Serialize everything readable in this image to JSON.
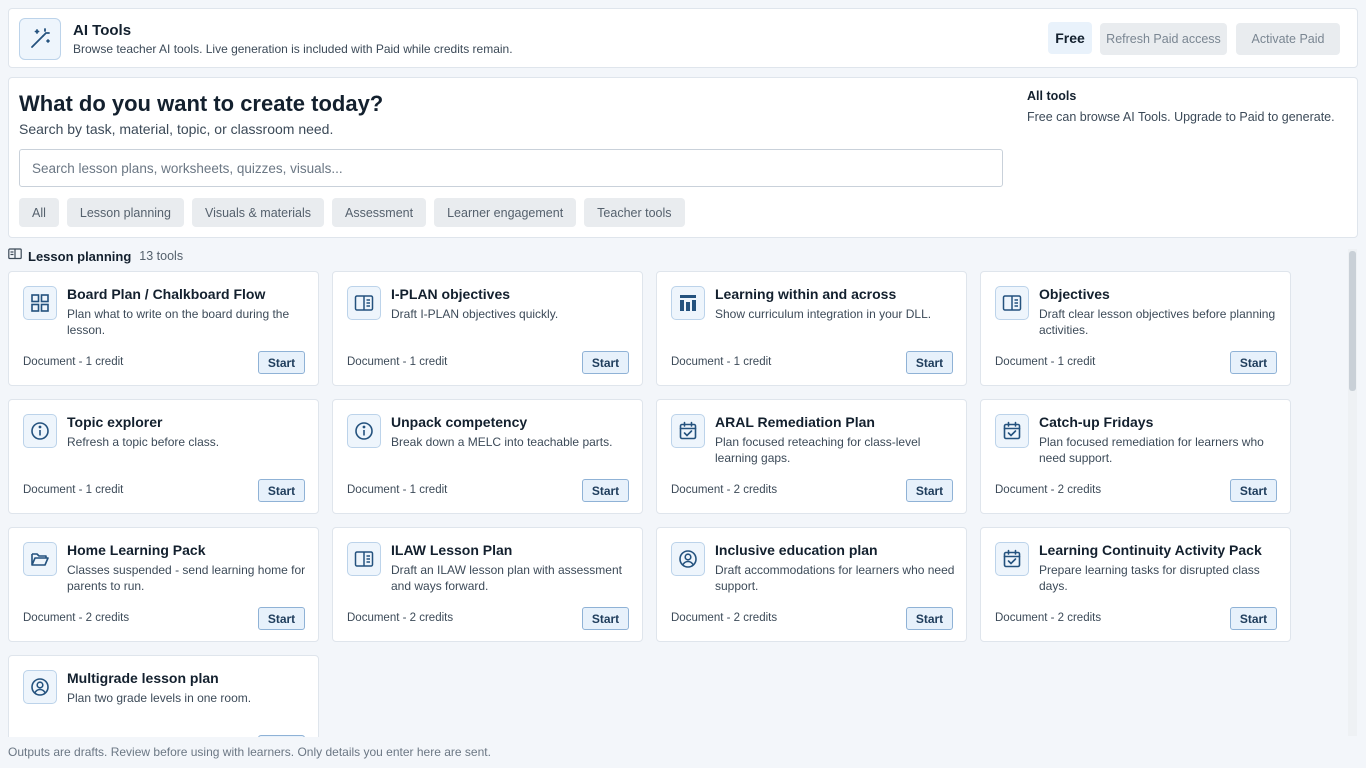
{
  "header": {
    "title": "AI Tools",
    "subtitle": "Browse teacher AI tools. Live generation is included with Paid while credits remain.",
    "plan_badge": "Free",
    "refresh_label": "Refresh Paid access",
    "activate_label": "Activate Paid",
    "icon": "magic-wand-icon"
  },
  "search": {
    "title": "What do you want to create today?",
    "subtitle": "Search by task, material, topic, or classroom need.",
    "placeholder": "Search lesson plans, worksheets, quizzes, visuals...",
    "value": "",
    "filters": [
      "All",
      "Lesson planning",
      "Visuals & materials",
      "Assessment",
      "Learner engagement",
      "Teacher tools"
    ]
  },
  "scope": {
    "title": "All tools",
    "description": "Free can browse AI Tools. Upgrade to Paid to generate."
  },
  "section": {
    "title": "Lesson planning",
    "count": "13 tools",
    "icon": "book-open-icon"
  },
  "tools": [
    {
      "title": "Board Plan / Chalkboard Flow",
      "desc": "Plan what to write on the board during the lesson.",
      "meta": "Document - 1 credit",
      "start": "Start",
      "icon": "grid-icon"
    },
    {
      "title": "I-PLAN objectives",
      "desc": "Draft I-PLAN objectives quickly.",
      "meta": "Document - 1 credit",
      "start": "Start",
      "icon": "book-icon"
    },
    {
      "title": "Learning within and across",
      "desc": "Show curriculum integration in your DLL.",
      "meta": "Document - 1 credit",
      "start": "Start",
      "icon": "layout-icon"
    },
    {
      "title": "Objectives",
      "desc": "Draft clear lesson objectives before planning activities.",
      "meta": "Document - 1 credit",
      "start": "Start",
      "icon": "book-icon"
    },
    {
      "title": "Topic explorer",
      "desc": "Refresh a topic before class.",
      "meta": "Document - 1 credit",
      "start": "Start",
      "icon": "info-icon"
    },
    {
      "title": "Unpack competency",
      "desc": "Break down a MELC into teachable parts.",
      "meta": "Document - 1 credit",
      "start": "Start",
      "icon": "info-icon"
    },
    {
      "title": "ARAL Remediation Plan",
      "desc": "Plan focused reteaching for class-level learning gaps.",
      "meta": "Document - 2 credits",
      "start": "Start",
      "icon": "calendar-check-icon"
    },
    {
      "title": "Catch-up Fridays",
      "desc": "Plan focused remediation for learners who need support.",
      "meta": "Document - 2 credits",
      "start": "Start",
      "icon": "calendar-check-icon"
    },
    {
      "title": "Home Learning Pack",
      "desc": "Classes suspended - send learning home for parents to run.",
      "meta": "Document - 2 credits",
      "start": "Start",
      "icon": "folder-open-icon"
    },
    {
      "title": "ILAW Lesson Plan",
      "desc": "Draft an ILAW lesson plan with assessment and ways forward.",
      "meta": "Document - 2 credits",
      "start": "Start",
      "icon": "book-icon"
    },
    {
      "title": "Inclusive education plan",
      "desc": "Draft accommodations for learners who need support.",
      "meta": "Document - 2 credits",
      "start": "Start",
      "icon": "user-circle-icon"
    },
    {
      "title": "Learning Continuity Activity Pack",
      "desc": "Prepare learning tasks for disrupted class days.",
      "meta": "Document - 2 credits",
      "start": "Start",
      "icon": "calendar-check-icon"
    },
    {
      "title": "Multigrade lesson plan",
      "desc": "Plan two grade levels in one room.",
      "meta": "",
      "start": "",
      "icon": "user-circle-icon"
    }
  ],
  "footer": {
    "note": "Outputs are drafts. Review before using with learners. Only details you enter here are sent."
  },
  "colors": {
    "accent": "#1f3d5c",
    "icon_stroke": "#24527e",
    "background": "#f3f6fa"
  }
}
